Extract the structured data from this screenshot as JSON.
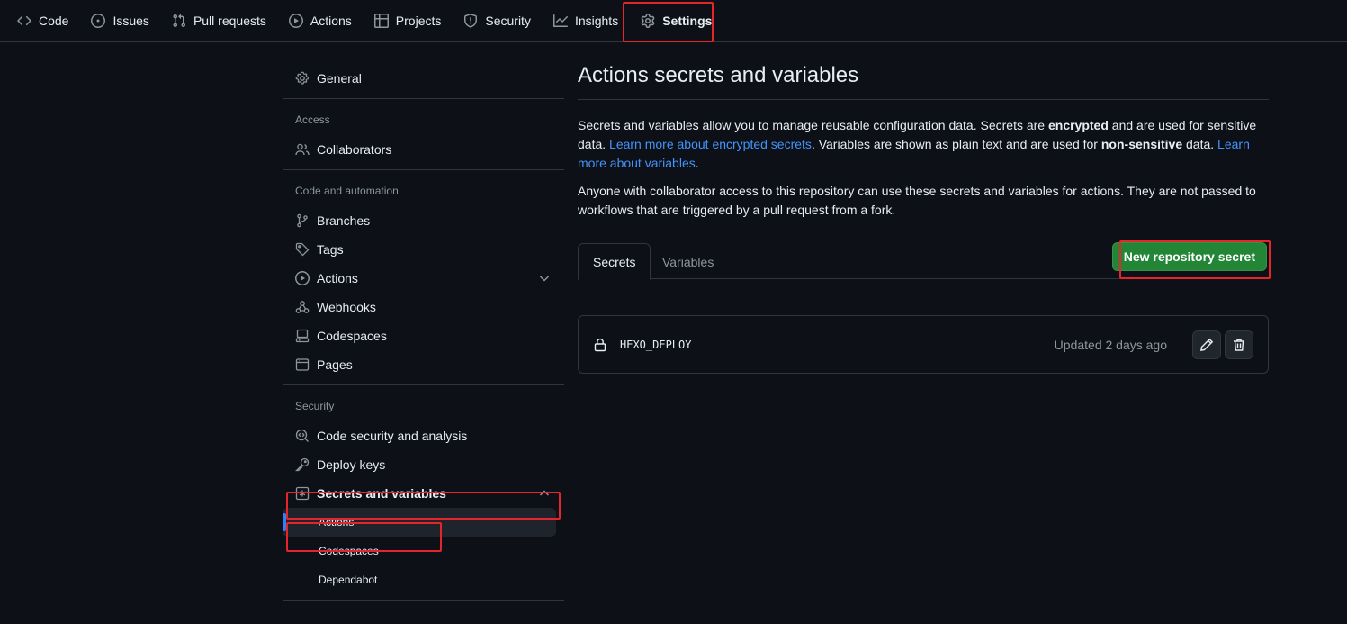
{
  "nav": {
    "items": [
      {
        "label": "Code",
        "icon": "code-icon"
      },
      {
        "label": "Issues",
        "icon": "issue-icon"
      },
      {
        "label": "Pull requests",
        "icon": "pull-request-icon"
      },
      {
        "label": "Actions",
        "icon": "play-icon"
      },
      {
        "label": "Projects",
        "icon": "table-icon"
      },
      {
        "label": "Security",
        "icon": "shield-icon"
      },
      {
        "label": "Insights",
        "icon": "graph-icon"
      },
      {
        "label": "Settings",
        "icon": "gear-icon"
      }
    ]
  },
  "sidebar": {
    "general": "General",
    "access_heading": "Access",
    "collaborators": "Collaborators",
    "code_heading": "Code and automation",
    "branches": "Branches",
    "tags": "Tags",
    "actions": "Actions",
    "webhooks": "Webhooks",
    "codespaces": "Codespaces",
    "pages": "Pages",
    "security_heading": "Security",
    "code_security": "Code security and analysis",
    "deploy_keys": "Deploy keys",
    "secrets": "Secrets and variables",
    "sub": {
      "actions": "Actions",
      "codespaces": "Codespaces",
      "dependabot": "Dependabot"
    }
  },
  "main": {
    "title": "Actions secrets and variables",
    "p1": {
      "a": "Secrets and variables allow you to manage reusable configuration data. Secrets are ",
      "b": "encrypted",
      "c": " and are used for sensitive data. ",
      "link1": "Learn more about encrypted secrets",
      "d": ". Variables are shown as plain text and are used for ",
      "e": "non-sensitive",
      "f": " data. ",
      "link2": "Learn more about variables",
      "g": "."
    },
    "p2": "Anyone with collaborator access to this repository can use these secrets and variables for actions. They are not passed to workflows that are triggered by a pull request from a fork.",
    "tabs": {
      "secrets": "Secrets",
      "variables": "Variables"
    },
    "new_button": "New repository secret",
    "secret": {
      "name": "HEXO_DEPLOY",
      "updated": "Updated 2 days ago"
    }
  },
  "colors": {
    "background": "#0d1117",
    "border": "#30363d",
    "link": "#4493f8",
    "primary_button": "#238636",
    "highlight": "#e5252a"
  }
}
